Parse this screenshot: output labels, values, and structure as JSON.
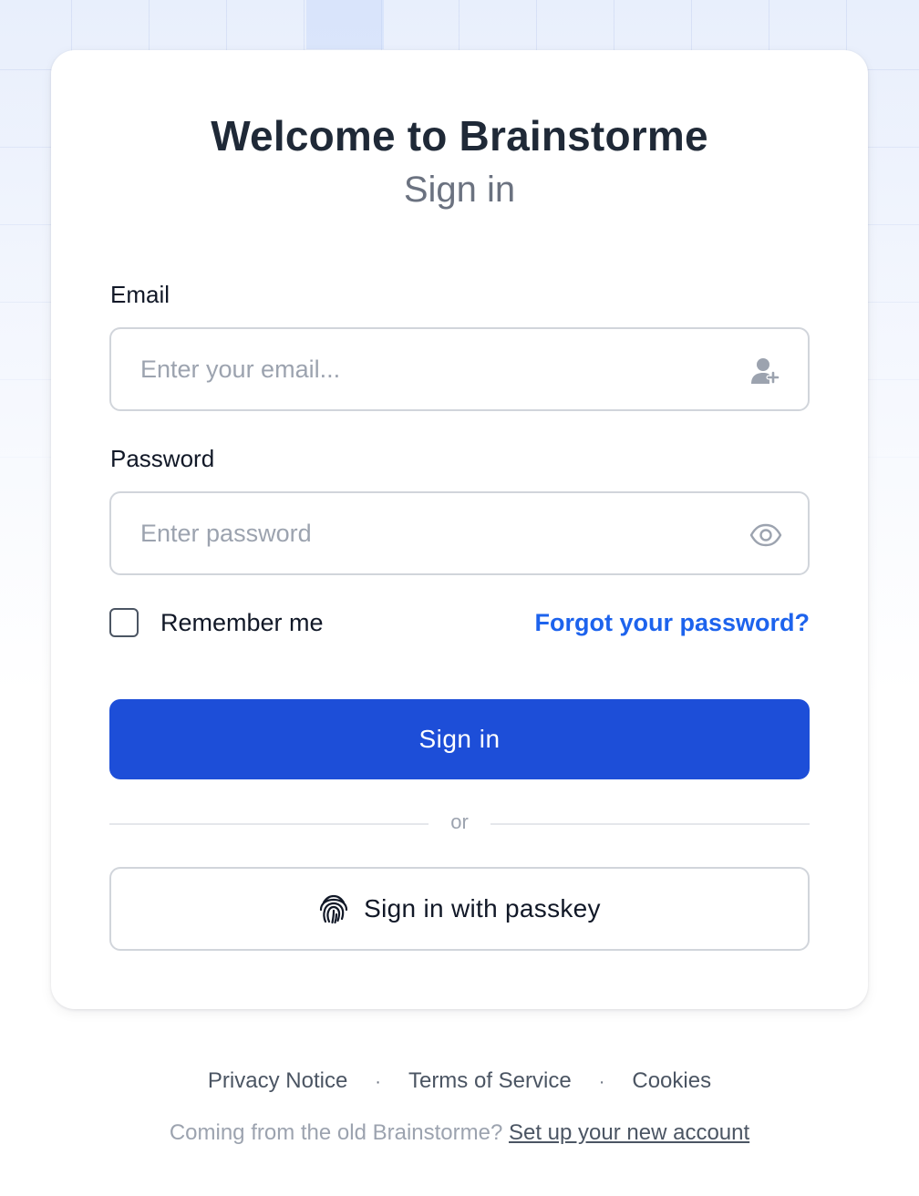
{
  "header": {
    "title": "Welcome to Brainstorme",
    "subtitle": "Sign in"
  },
  "form": {
    "email_label": "Email",
    "email_placeholder": "Enter your email...",
    "email_value": "",
    "password_label": "Password",
    "password_placeholder": "Enter password",
    "password_value": "",
    "remember_label": "Remember me",
    "remember_checked": false,
    "forgot_label": "Forgot your password?",
    "submit_label": "Sign in",
    "divider_text": "or",
    "passkey_label": "Sign in with passkey"
  },
  "footer": {
    "links": [
      "Privacy Notice",
      "Terms of Service",
      "Cookies"
    ],
    "separator": "·",
    "legacy_text": "Coming from the old Brainstorme?",
    "legacy_link": "Set up your new account"
  },
  "colors": {
    "primary": "#1d4ed8",
    "link": "#1d63ed",
    "text": "#111827",
    "muted": "#6b7280",
    "border": "#d1d5db"
  },
  "icons": {
    "email_field": "user-plus-icon",
    "password_field": "eye-icon",
    "passkey_button": "fingerprint-icon"
  }
}
